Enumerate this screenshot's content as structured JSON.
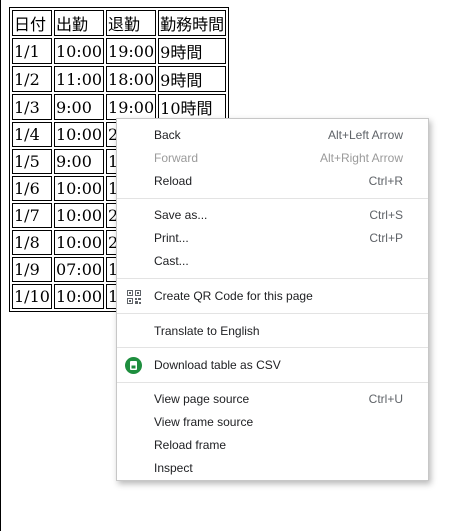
{
  "table": {
    "headers": [
      "日付",
      "出勤",
      "退勤",
      "勤務時間"
    ],
    "rows": [
      [
        "1/1",
        "10:00",
        "19:00",
        "9時間"
      ],
      [
        "1/2",
        "11:00",
        "18:00",
        "9時間"
      ],
      [
        "1/3",
        "9:00",
        "19:00",
        "10時間"
      ],
      [
        "1/4",
        "10:00",
        "20:",
        ""
      ],
      [
        "1/5",
        "9:00",
        "10:",
        ""
      ],
      [
        "1/6",
        "10:00",
        "17:",
        ""
      ],
      [
        "1/7",
        "10:00",
        "22:",
        ""
      ],
      [
        "1/8",
        "10:00",
        "21:",
        ""
      ],
      [
        "1/9",
        "07:00",
        "19:",
        ""
      ],
      [
        "1/10",
        "10:00",
        "19:",
        ""
      ]
    ]
  },
  "context_menu": {
    "back": {
      "label": "Back",
      "shortcut": "Alt+Left Arrow"
    },
    "forward": {
      "label": "Forward",
      "shortcut": "Alt+Right Arrow"
    },
    "reload": {
      "label": "Reload",
      "shortcut": "Ctrl+R"
    },
    "save_as": {
      "label": "Save as...",
      "shortcut": "Ctrl+S"
    },
    "print": {
      "label": "Print...",
      "shortcut": "Ctrl+P"
    },
    "cast": {
      "label": "Cast..."
    },
    "qr_code": {
      "label": "Create QR Code for this page",
      "icon": "qr-code-icon"
    },
    "translate": {
      "label": "Translate to English"
    },
    "download_csv": {
      "label": "Download table as CSV",
      "icon": "extension-download-icon",
      "icon_color": "#1e8e3e"
    },
    "view_source": {
      "label": "View page source",
      "shortcut": "Ctrl+U"
    },
    "view_frame_source": {
      "label": "View frame source"
    },
    "reload_frame": {
      "label": "Reload frame"
    },
    "inspect": {
      "label": "Inspect"
    }
  }
}
